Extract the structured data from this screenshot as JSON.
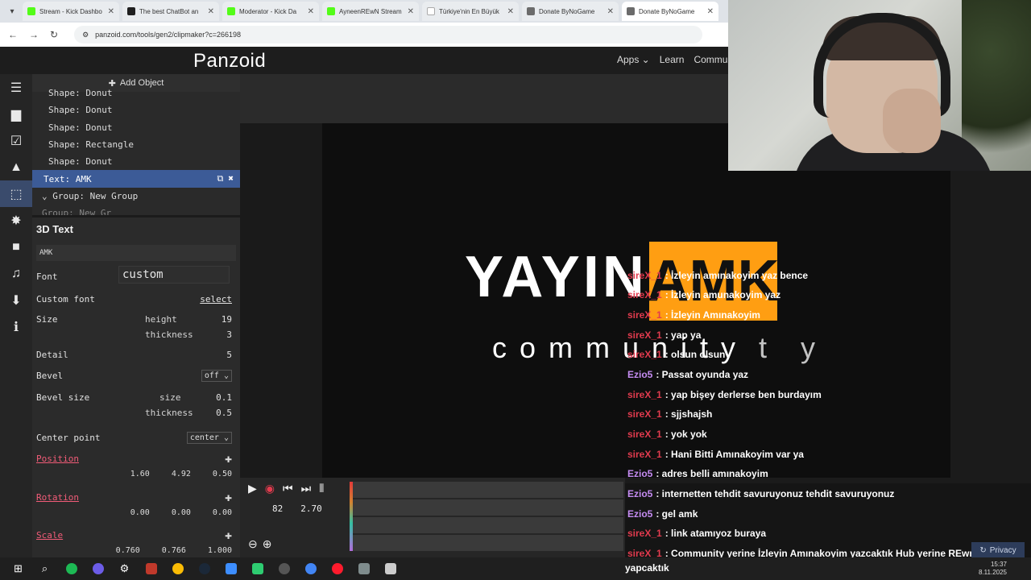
{
  "browser": {
    "tabs": [
      {
        "title": "Stream - Kick Dashbo",
        "color": "#53fc18"
      },
      {
        "title": "The best ChatBot an",
        "color": "#1f1f1f"
      },
      {
        "title": "Moderator - Kick Da",
        "color": "#53fc18"
      },
      {
        "title": "AyneenREwN Stream",
        "color": "#53fc18"
      },
      {
        "title": "Türkiye'nin En Büyük",
        "color": "#ffffff"
      },
      {
        "title": "Donate ByNoGame",
        "color": "#6b6b6b"
      },
      {
        "title": "Donate ByNoGame",
        "color": "#6b6b6b"
      }
    ],
    "url": "panzoid.com/tools/gen2/clipmaker?c=266198"
  },
  "site": {
    "logo": "Panzoid",
    "nav": [
      "Apps ⌄",
      "Learn",
      "Commu"
    ]
  },
  "sidebar_icons": [
    "menu-icon",
    "folder-icon",
    "checkbox-icon",
    "image-icon",
    "cube-icon",
    "burst-icon",
    "camera-icon",
    "music-icon",
    "download-icon",
    "info-icon"
  ],
  "objects": {
    "add_label": "Add Object",
    "items": [
      "Shape: Donut",
      "Shape: Donut",
      "Shape: Donut",
      "Shape: Rectangle",
      "Shape: Donut"
    ],
    "selected": "Text: AMK",
    "group": "Group: New Group",
    "partial": "Group: New Gr"
  },
  "props": {
    "title": "3D Text",
    "text_value": "AMK",
    "font_label": "Font",
    "font_value": "custom",
    "custom_font_label": "Custom font",
    "custom_font_link": "select",
    "size_label": "Size",
    "height_label": "height",
    "height_value": "19",
    "thickness_label": "thickness",
    "thickness_value": "3",
    "detail_label": "Detail",
    "detail_value": "5",
    "bevel_label": "Bevel",
    "bevel_value": "off ⌄",
    "bevel_size_label": "Bevel size",
    "bevel_size_sub": "size",
    "bevel_size_value": "0.1",
    "bevel_thick_sub": "thickness",
    "bevel_thick_value": "0.5",
    "center_label": "Center point",
    "center_value": "center ⌄",
    "position_label": "Position",
    "position_values": [
      "1.60",
      "4.92",
      "0.50"
    ],
    "rotation_label": "Rotation",
    "rotation_values": [
      "0.00",
      "0.00",
      "0.00"
    ],
    "scale_label": "Scale",
    "scale_values": [
      "0.760",
      "0.766",
      "1.000"
    ]
  },
  "timeline": {
    "frame": "82",
    "time": "2.70"
  },
  "canvas": {
    "title": "YAYIN",
    "overlay": "AMK",
    "subtitle": "community",
    "subtitle_tail": "t y",
    "accent": "#ff9e12"
  },
  "chat": [
    {
      "user": "sireX_1",
      "text": ": İzleyin amınakoyim yaz bence",
      "color": "#e23b4e"
    },
    {
      "user": "sireX_1",
      "text": ": İzleyin amunakoyim yaz",
      "color": "#e23b4e"
    },
    {
      "user": "sireX_1",
      "text": ": İzleyin Amınakoyim",
      "color": "#e23b4e"
    },
    {
      "user": "sireX_1",
      "text": ": yap ya",
      "color": "#e23b4e"
    },
    {
      "user": "sireX_1",
      "text": ": olsun olsun",
      "color": "#e23b4e"
    },
    {
      "user": "Ezio5",
      "text": ": Passat oyunda yaz",
      "color": "#c58cf2"
    },
    {
      "user": "sireX_1",
      "text": ": yap bişey derlerse ben burdayım",
      "color": "#e23b4e"
    },
    {
      "user": "sireX_1",
      "text": ": sjjshajsh",
      "color": "#e23b4e"
    },
    {
      "user": "sireX_1",
      "text": ": yok yok",
      "color": "#e23b4e"
    },
    {
      "user": "sireX_1",
      "text": ": Hani Bitti Amınakoyim var ya",
      "color": "#e23b4e"
    },
    {
      "user": "Ezio5",
      "text": ": adres belli amınakoyim",
      "color": "#c58cf2"
    },
    {
      "user": "Ezio5",
      "text": ": internetten tehdit savuruyonuz tehdit savuruyonuz",
      "color": "#c58cf2"
    },
    {
      "user": "Ezio5",
      "text": ": gel amk",
      "color": "#c58cf2"
    },
    {
      "user": "sireX_1",
      "text": ": link atamıyoz buraya",
      "color": "#e23b4e"
    },
    {
      "user": "sireX_1",
      "text": ": Community yerine İzleyin Amınakoyim yazcaktık Hub yerine REwn",
      "color": "#e23b4e"
    }
  ],
  "chat_wrap": "yapcaktık",
  "privacy": "Privacy",
  "tray": {
    "time": "15:37",
    "date": "8.11.2025"
  }
}
